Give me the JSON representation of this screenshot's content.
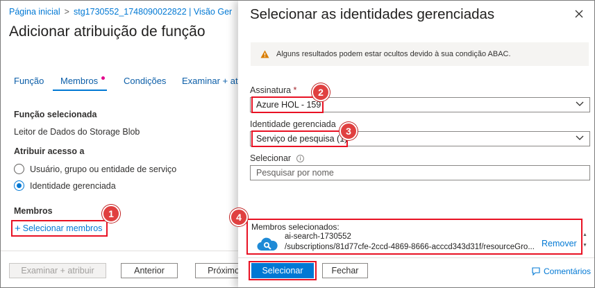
{
  "breadcrumb": {
    "home": "Página inicial",
    "sep": ">",
    "resource": "stg1730552_1748090022822 | Visão Ger"
  },
  "left": {
    "title": "Adicionar atribuição de função",
    "tabs": [
      "Função",
      "Membros",
      "Condições",
      "Examinar + at"
    ],
    "role_section_label": "Função selecionada",
    "role_value": "Leitor de Dados do Storage Blob",
    "assign_access_label": "Atribuir acesso a",
    "radio_options": [
      "Usuário, grupo ou entidade de serviço",
      "Identidade gerenciada"
    ],
    "members_label": "Membros",
    "select_members_link": "Selecionar membros",
    "buttons": {
      "review_assign": "Examinar + atribuir",
      "previous": "Anterior",
      "next": "Próximo"
    }
  },
  "panel": {
    "title": "Selecionar as identidades gerenciadas",
    "warning": "Alguns resultados podem estar ocultos devido à sua condição ABAC.",
    "subscription_label": "Assinatura",
    "required_mark": "*",
    "subscription_value": "Azure HOL - 159",
    "managed_identity_label": "Identidade gerenciada",
    "managed_identity_value": "Serviço de pesquisa (1)",
    "select_label": "Selecionar",
    "info_glyph": "i",
    "search_placeholder": "Pesquisar por nome",
    "selected_members_label": "Membros selecionados:",
    "member_name": "ai-search-1730552",
    "member_path": "/subscriptions/81d77cfe-2ccd-4869-8666-acccd343d31f/resourceGro...",
    "remove_label": "Remover",
    "select_button": "Selecionar",
    "close_button": "Fechar",
    "feedback_label": "Comentários"
  },
  "callouts": [
    "1",
    "2",
    "3",
    "4"
  ],
  "colors": {
    "accent": "#0078d4",
    "highlight": "#e81123",
    "callout": "#e04040",
    "warning_icon": "#d97d00"
  },
  "icons": [
    "close-icon",
    "warning-icon",
    "chevron-down-icon",
    "info-icon",
    "cloud-search-icon",
    "feedback-icon",
    "scroll-up-icon",
    "scroll-down-icon"
  ]
}
